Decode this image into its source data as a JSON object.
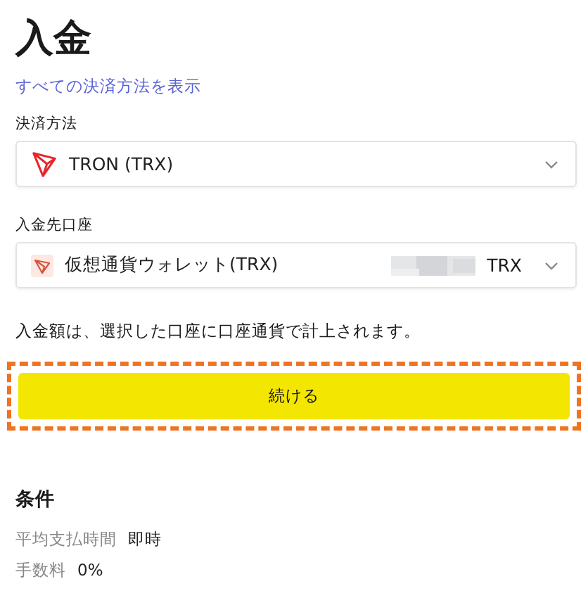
{
  "title": "入金",
  "link": "すべての決済方法を表示",
  "fields": [
    {
      "label": "決済方法",
      "value": "TRON (TRX)",
      "kind": "method",
      "redacted": false
    },
    {
      "label": "入金先口座",
      "value": "仮想通貨ウォレット(TRX)",
      "kind": "account",
      "redacted": true,
      "suffix": "TRX"
    }
  ],
  "note": "入金額は、選択した口座に口座通貨で計上されます。",
  "button": {
    "label": "続ける",
    "highlighted": true
  },
  "conditions": {
    "title": "条件",
    "rows": [
      {
        "label": "平均支払時間",
        "value": "即時"
      },
      {
        "label": "手数料",
        "value": "0%"
      }
    ]
  }
}
